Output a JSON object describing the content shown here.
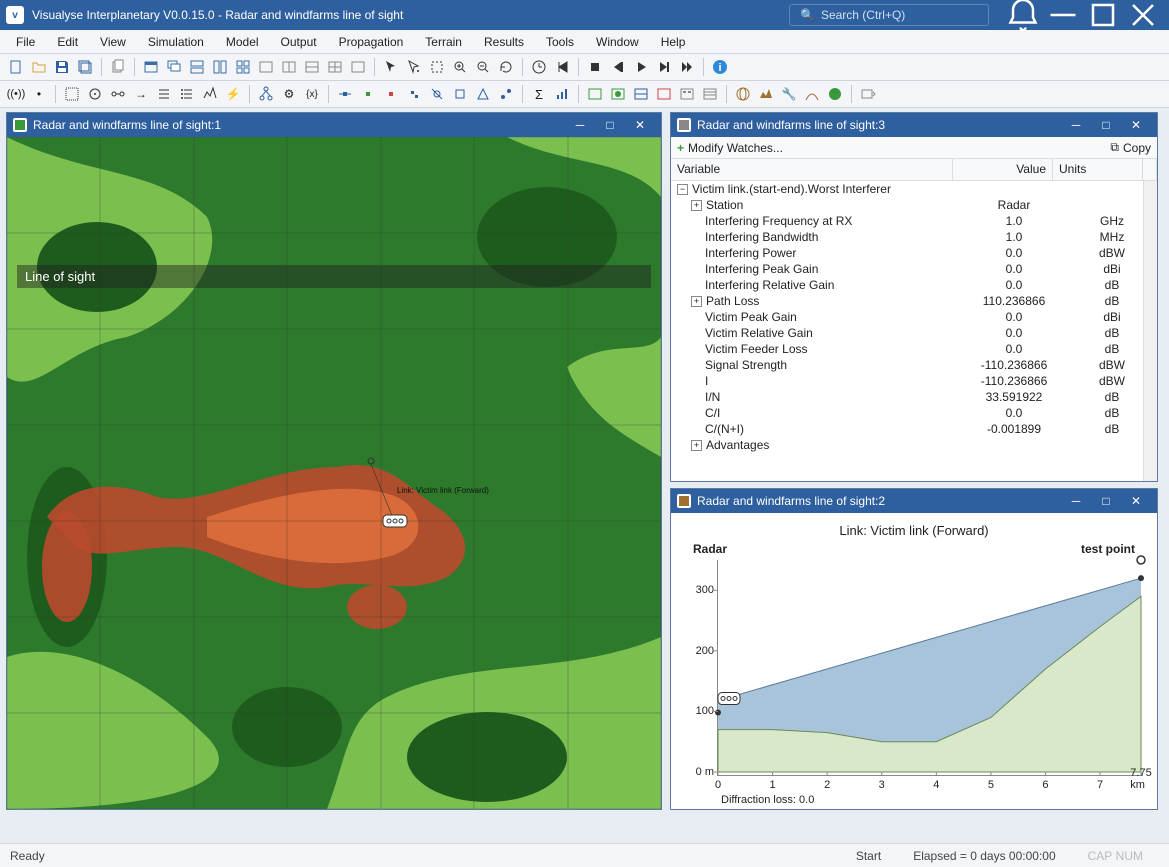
{
  "app": {
    "title": "Visualyse Interplanetary V0.0.15.0 - Radar and windfarms line of sight",
    "search_placeholder": "Search (Ctrl+Q)"
  },
  "menu": [
    "File",
    "Edit",
    "View",
    "Simulation",
    "Model",
    "Output",
    "Propagation",
    "Terrain",
    "Results",
    "Tools",
    "Window",
    "Help"
  ],
  "subwindows": {
    "map": {
      "title": "Radar and windfarms line of sight:1",
      "overlay_label": "Line of sight",
      "station_label": "Link: Victim link (Forward)"
    },
    "watch": {
      "title": "Radar and windfarms line of sight:3",
      "modify": "Modify Watches...",
      "copy": "Copy",
      "columns": {
        "var": "Variable",
        "val": "Value",
        "unit": "Units"
      },
      "group": "Victim link.(start-end).Worst Interferer",
      "rows": [
        {
          "var": "Station",
          "val": "Radar",
          "unit": "",
          "expandable": true,
          "indent": 1
        },
        {
          "var": "Interfering Frequency at RX",
          "val": "1.0",
          "unit": "GHz",
          "indent": 2
        },
        {
          "var": "Interfering Bandwidth",
          "val": "1.0",
          "unit": "MHz",
          "indent": 2
        },
        {
          "var": "Interfering Power",
          "val": "0.0",
          "unit": "dBW",
          "indent": 2
        },
        {
          "var": "Interfering Peak Gain",
          "val": "0.0",
          "unit": "dBi",
          "indent": 2
        },
        {
          "var": "Interfering Relative Gain",
          "val": "0.0",
          "unit": "dB",
          "indent": 2
        },
        {
          "var": "Path Loss",
          "val": "110.236866",
          "unit": "dB",
          "expandable": true,
          "indent": 1
        },
        {
          "var": "Victim Peak Gain",
          "val": "0.0",
          "unit": "dBi",
          "indent": 2
        },
        {
          "var": "Victim Relative Gain",
          "val": "0.0",
          "unit": "dB",
          "indent": 2
        },
        {
          "var": "Victim Feeder Loss",
          "val": "0.0",
          "unit": "dB",
          "indent": 2
        },
        {
          "var": "Signal Strength",
          "val": "-110.236866",
          "unit": "dBW",
          "indent": 2
        },
        {
          "var": "I",
          "val": "-110.236866",
          "unit": "dBW",
          "indent": 2
        },
        {
          "var": "I/N",
          "val": "33.591922",
          "unit": "dB",
          "indent": 2
        },
        {
          "var": "C/I",
          "val": "0.0",
          "unit": "dB",
          "indent": 2
        },
        {
          "var": "C/(N+I)",
          "val": "-0.001899",
          "unit": "dB",
          "indent": 2
        },
        {
          "var": "Advantages",
          "val": "",
          "unit": "",
          "expandable": true,
          "indent": 1
        }
      ]
    },
    "profile": {
      "title": "Radar and windfarms line of sight:2",
      "link_title": "Link: Victim link (Forward)",
      "left_label": "Radar",
      "right_label": "test point",
      "footer": "Diffraction loss: 0.0"
    }
  },
  "status": {
    "ready": "Ready",
    "start": "Start",
    "elapsed": "Elapsed = 0 days 00:00:00",
    "cap": "CAP",
    "num": "NUM"
  },
  "chart_data": {
    "type": "area",
    "title": "Link: Victim link (Forward)",
    "xlabel": "km",
    "ylabel": "m",
    "x": [
      0,
      1,
      2,
      3,
      4,
      5,
      6,
      7,
      7.75
    ],
    "terrain_height": [
      70,
      70,
      65,
      50,
      50,
      90,
      170,
      240,
      290
    ],
    "tx_height": 118,
    "rx_height": 320,
    "rx_antenna_top": 350,
    "xlim": [
      0,
      7.75
    ],
    "ylim": [
      0,
      350
    ],
    "xticks": [
      0,
      1,
      2,
      3,
      4,
      5,
      6,
      7,
      7.75
    ],
    "yticks": [
      0,
      100,
      200,
      300
    ],
    "xtick_labels": [
      "0",
      "1",
      "2",
      "3",
      "4",
      "5",
      "6",
      "7",
      "7.75 km"
    ],
    "ytick_labels": [
      "0 m",
      "100",
      "200",
      "300"
    ]
  }
}
